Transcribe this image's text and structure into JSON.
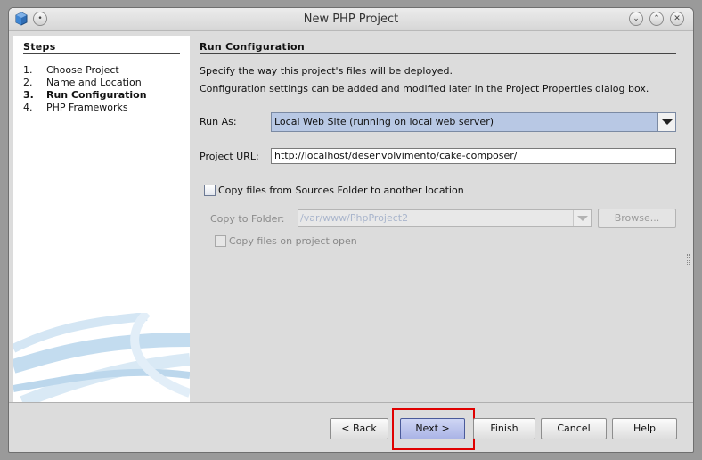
{
  "window": {
    "title": "New PHP Project",
    "controls": [
      "minimize-icon",
      "maximize-icon",
      "close-icon"
    ]
  },
  "steps": {
    "title": "Steps",
    "items": [
      {
        "num": "1.",
        "label": "Choose Project",
        "current": false
      },
      {
        "num": "2.",
        "label": "Name and Location",
        "current": false
      },
      {
        "num": "3.",
        "label": "Run Configuration",
        "current": true
      },
      {
        "num": "4.",
        "label": "PHP Frameworks",
        "current": false
      }
    ]
  },
  "main": {
    "title": "Run Configuration",
    "desc_line1": "Specify the way this project's files will be deployed.",
    "desc_line2": "Configuration settings can be added and modified later in the Project Properties dialog box.",
    "run_as": {
      "label": "Run As:",
      "value": "Local Web Site (running on local web server)"
    },
    "project_url": {
      "label": "Project URL:",
      "value": "http://localhost/desenvolvimento/cake-composer/"
    },
    "copy_files": {
      "label": "Copy files from Sources Folder to another location",
      "checked": false
    },
    "copy_to_folder": {
      "label": "Copy to Folder:",
      "value": "/var/www/PhpProject2"
    },
    "browse_label": "Browse...",
    "copy_on_open": {
      "label": "Copy files on project open",
      "checked": false
    }
  },
  "footer": {
    "back": "< Back",
    "next": "Next >",
    "finish": "Finish",
    "cancel": "Cancel",
    "help": "Help"
  },
  "colors": {
    "selected_combo": "#b8c8e4",
    "primary_button": "#aab4e6",
    "highlight_box": "#e00000"
  }
}
